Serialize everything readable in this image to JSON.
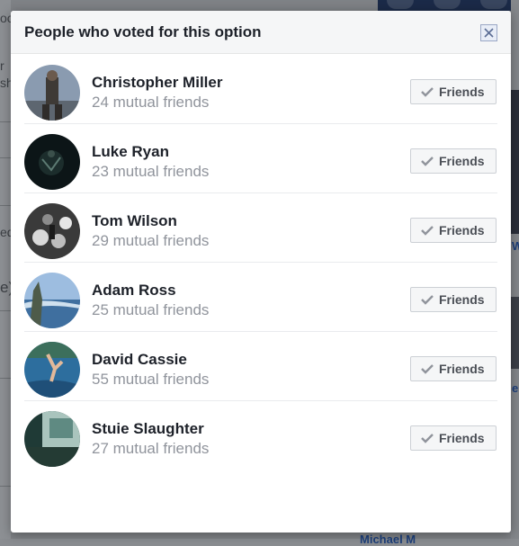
{
  "background": {
    "left_fragments": [
      "oo",
      "r",
      "sh",
      "ed",
      "e)"
    ],
    "right_fragments": [
      "W",
      "e"
    ],
    "bottom_fragment": "Michael M"
  },
  "dialog": {
    "title": "People who voted for this option",
    "close_icon": "close-icon"
  },
  "voters": [
    {
      "name": "Christopher Miller",
      "mutual": "24 mutual friends",
      "button": "Friends",
      "avatar_color": "#7d8ea3"
    },
    {
      "name": "Luke Ryan",
      "mutual": "23 mutual friends",
      "button": "Friends",
      "avatar_color": "#0e1a1c"
    },
    {
      "name": "Tom Wilson",
      "mutual": "29 mutual friends",
      "button": "Friends",
      "avatar_color": "#4a4a4a"
    },
    {
      "name": "Adam Ross",
      "mutual": "25 mutual friends",
      "button": "Friends",
      "avatar_color": "#7fa6cf"
    },
    {
      "name": "David Cassie",
      "mutual": "55 mutual friends",
      "button": "Friends",
      "avatar_color": "#2f6d9a"
    },
    {
      "name": "Stuie Slaughter",
      "mutual": "27 mutual friends",
      "button": "Friends",
      "avatar_color": "#2b4a47"
    }
  ],
  "colors": {
    "title_text": "#1d2129",
    "secondary_text": "#90949c",
    "button_bg": "#f5f6f7",
    "button_text": "#4b4f56"
  }
}
